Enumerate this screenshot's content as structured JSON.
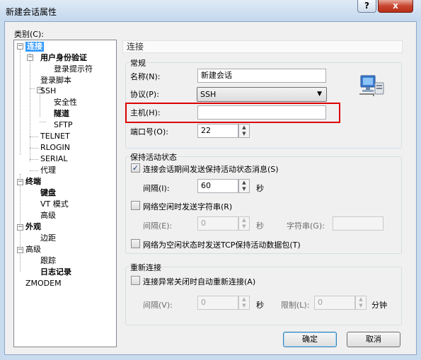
{
  "window": {
    "title": "新建会话属性",
    "help_label": "?",
    "close_label": "x"
  },
  "category_label": "类别(C):",
  "tree": {
    "connection": "连接",
    "auth": "用户身份验证",
    "login_prompt": "登录提示符",
    "login_script": "登录脚本",
    "ssh": "SSH",
    "security": "安全性",
    "tunnel": "隧道",
    "sftp": "SFTP",
    "telnet": "TELNET",
    "rlogin": "RLOGIN",
    "serial": "SERIAL",
    "proxy": "代理",
    "terminal": "终端",
    "keyboard": "键盘",
    "vt_mode": "VT 模式",
    "advanced1": "高级",
    "appearance": "外观",
    "margin": "边距",
    "advanced": "高级",
    "trace": "跟踪",
    "logging": "日志记录",
    "zmodem": "ZMODEM",
    "expand_symbol": "−"
  },
  "pane_title": "连接",
  "general": {
    "title": "常规",
    "name_label": "名称(N):",
    "name_value": "新建会话",
    "protocol_label": "协议(P):",
    "protocol_value": "SSH",
    "host_label": "主机(H):",
    "host_value": "",
    "port_label": "端口号(O):",
    "port_value": "22"
  },
  "keepalive": {
    "title": "保持活动状态",
    "send_label": "连接会话期间发送保持活动状态消息(S)",
    "send_checked": true,
    "check_mark": "✓",
    "interval_label": "间隔(I):",
    "interval_value": "60",
    "seconds": "秒",
    "idle_label": "网络空闲时发送字符串(R)",
    "idle_checked": false,
    "idle_interval_label": "间隔(E):",
    "idle_interval_value": "0",
    "idle_seconds": "秒",
    "string_label": "字符串(G):",
    "string_value": "",
    "tcp_label": "网络为空闲状态时发送TCP保持活动数据包(T)",
    "tcp_checked": false
  },
  "reconnect": {
    "title": "重新连接",
    "auto_label": "连接异常关闭时自动重新连接(A)",
    "auto_checked": false,
    "interval_label": "间隔(V):",
    "interval_value": "0",
    "seconds": "秒",
    "limit_label": "限制(L):",
    "limit_value": "0",
    "minutes": "分钟"
  },
  "buttons": {
    "ok": "确定",
    "cancel": "取消"
  },
  "spin_symbols": {
    "up": "▲",
    "down": "▼",
    "dropdown": "▼"
  },
  "colors": {
    "highlight": "#dd0000",
    "tree_selection": "#3399ff"
  }
}
